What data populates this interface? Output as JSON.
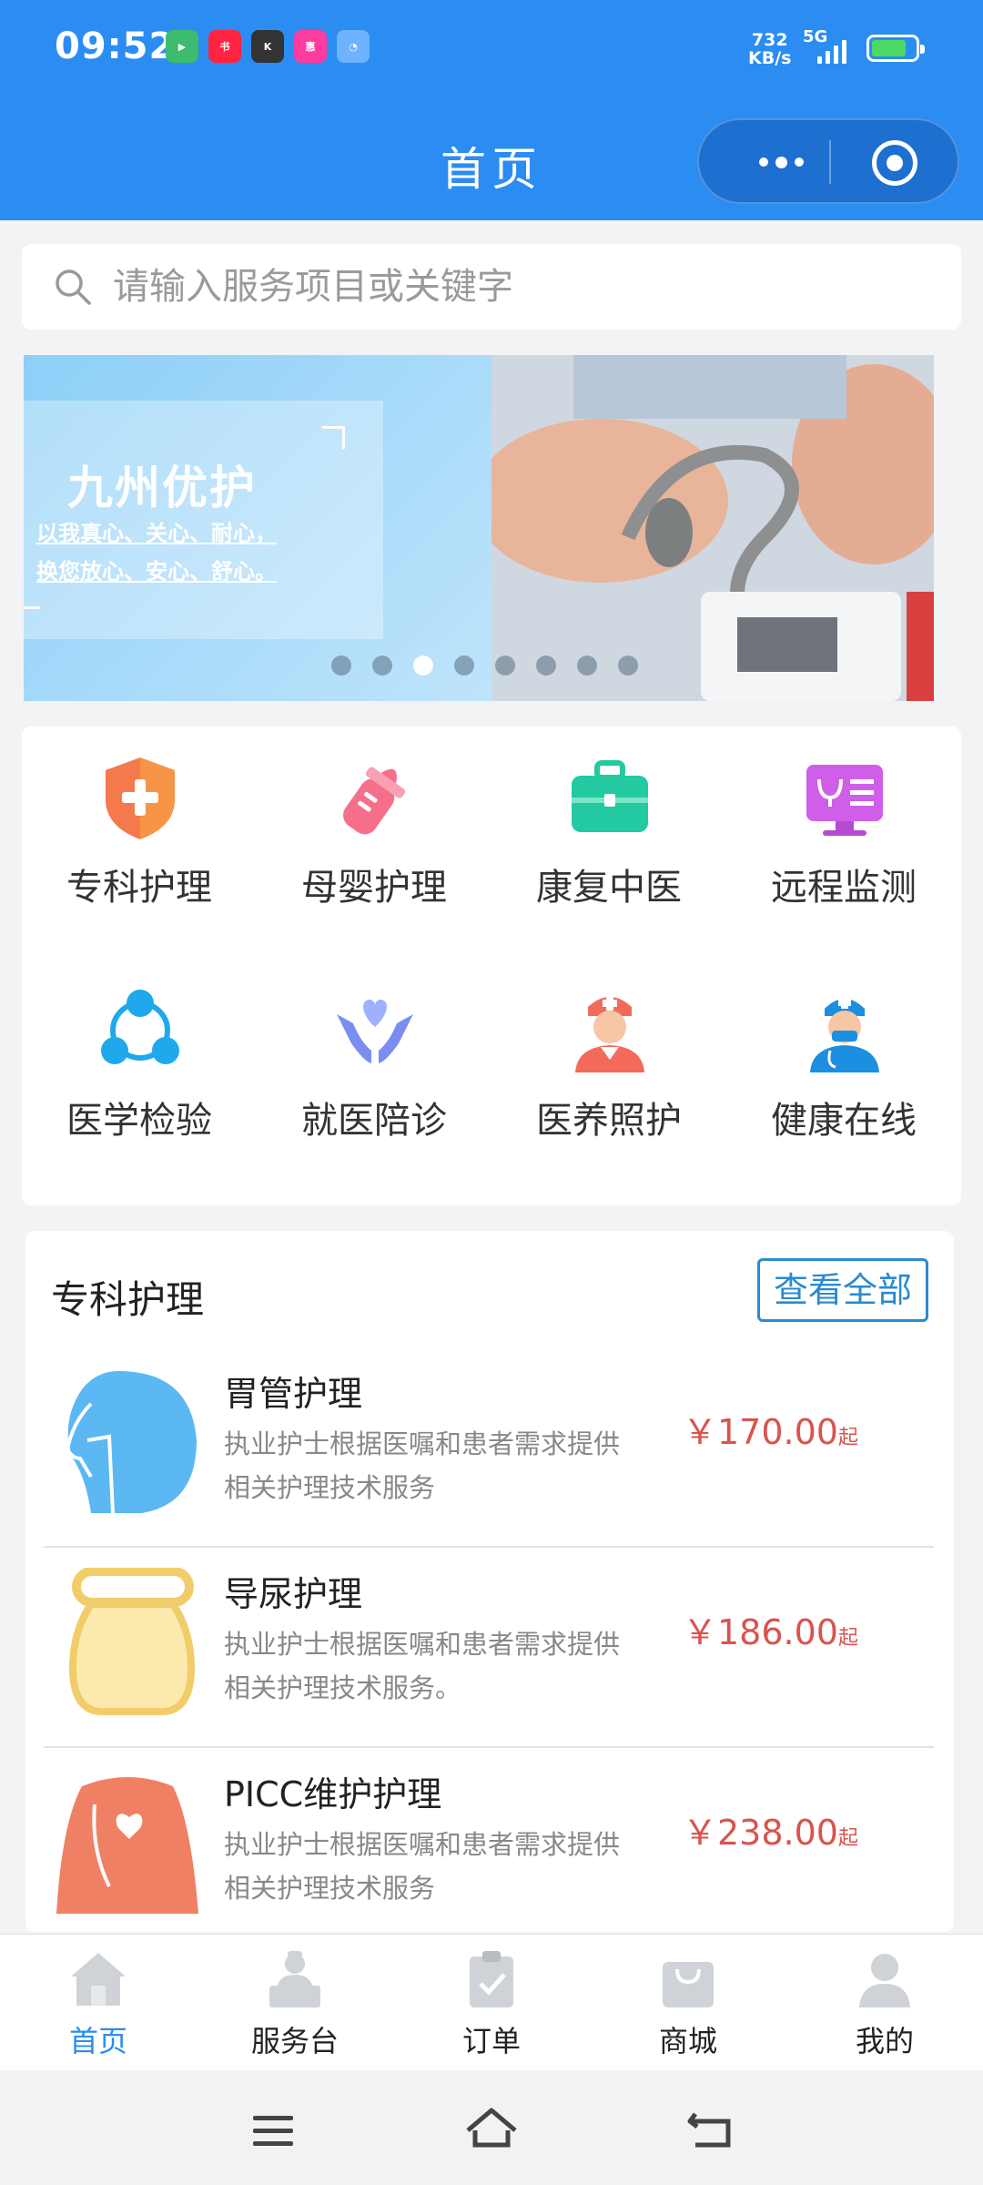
{
  "status_bar": {
    "time": "09:52",
    "net_speed_value": "732",
    "net_speed_unit": "KB/s",
    "network": "5G",
    "battery_level": 0.8,
    "notification_icons": [
      "video-app-icon",
      "xiaohongshu-icon",
      "k-app-icon",
      "shopping-app-icon",
      "clock-app-icon"
    ]
  },
  "header": {
    "title": "首页",
    "capsule_icons": [
      "more-icon",
      "close-target-icon"
    ]
  },
  "search": {
    "placeholder": "请输入服务项目或关键字"
  },
  "banner": {
    "title": "九州优护",
    "subtitle_line1": "以我真心、关心、耐心，",
    "subtitle_line2": "换您放心、安心、舒心。",
    "dot_count": 8,
    "active_dot": 3
  },
  "categories": [
    {
      "label": "专科护理",
      "icon": "shield-plus-icon",
      "color": "#f47a4e"
    },
    {
      "label": "母婴护理",
      "icon": "baby-bottle-icon",
      "color": "#f66f8a"
    },
    {
      "label": "康复中医",
      "icon": "medical-kit-icon",
      "color": "#22c9a1"
    },
    {
      "label": "远程监测",
      "icon": "remote-monitor-icon",
      "color": "#cf5ee8"
    },
    {
      "label": "医学检验",
      "icon": "lab-test-icon",
      "color": "#1fa9ec"
    },
    {
      "label": "就医陪诊",
      "icon": "caring-hands-icon",
      "color": "#7b8df0"
    },
    {
      "label": "医养照护",
      "icon": "nurse-icon",
      "color": "#f36a5b"
    },
    {
      "label": "健康在线",
      "icon": "doctor-icon",
      "color": "#1d8fe0"
    }
  ],
  "section": {
    "title": "专科护理",
    "view_all": "查看全部",
    "items": [
      {
        "name": "胃管护理",
        "desc": "执业护士根据医嘱和患者需求提供相关护理技术服务",
        "price": "￥170.00",
        "price_suffix": "起",
        "icon": "gastric-tube-icon"
      },
      {
        "name": "导尿护理",
        "desc": "执业护士根据医嘱和患者需求提供相关护理技术服务。",
        "price": "￥186.00",
        "price_suffix": "起",
        "icon": "urine-bottle-icon"
      },
      {
        "name": "PICC维护护理",
        "desc": "执业护士根据医嘱和患者需求提供相关护理技术服务",
        "price": "￥238.00",
        "price_suffix": "起",
        "icon": "picc-body-icon"
      }
    ]
  },
  "tabbar": [
    {
      "label": "首页",
      "icon": "home-icon",
      "active": true
    },
    {
      "label": "服务台",
      "icon": "service-desk-icon",
      "active": false
    },
    {
      "label": "订单",
      "icon": "order-clipboard-icon",
      "active": false
    },
    {
      "label": "商城",
      "icon": "shopping-bag-icon",
      "active": false
    },
    {
      "label": "我的",
      "icon": "user-icon",
      "active": false
    }
  ],
  "colors": {
    "primary": "#2b8cf2",
    "price": "#d9534f",
    "link_border": "#2b8ad0"
  }
}
